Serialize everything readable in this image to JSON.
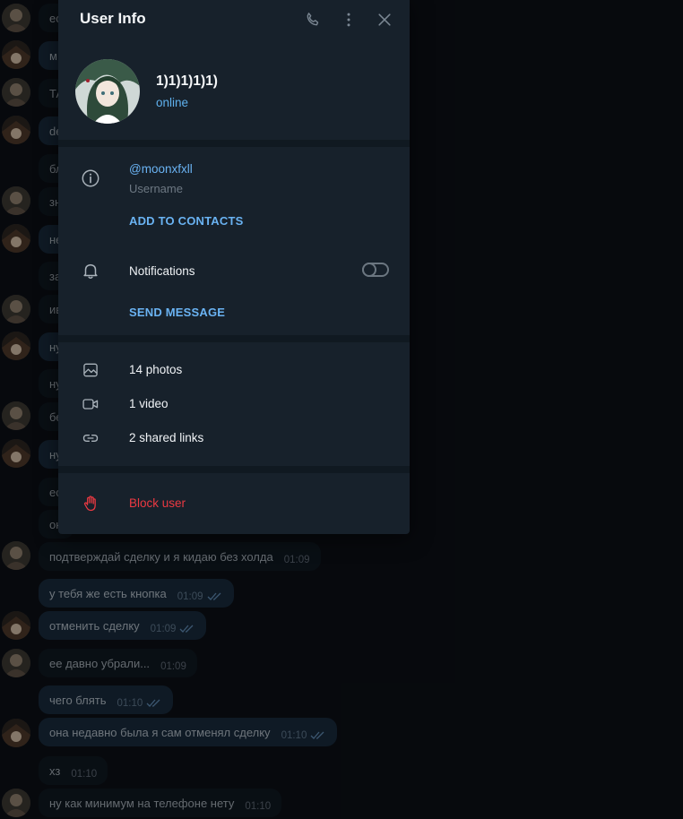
{
  "panel": {
    "title": "User Info",
    "name": "1)1)1)1)1)",
    "status": "online",
    "username": "@moonxfxll",
    "username_caption": "Username",
    "add_contacts": "ADD TO CONTACTS",
    "notifications": "Notifications",
    "notifications_enabled": false,
    "send_message": "SEND MESSAGE",
    "media": [
      {
        "label": "14 photos",
        "icon": "photo-icon"
      },
      {
        "label": "1 video",
        "icon": "video-icon"
      },
      {
        "label": "2 shared links",
        "icon": "link-icon"
      }
    ],
    "block": "Block user",
    "colors": {
      "accent": "#6ab3f3",
      "danger": "#ec3942",
      "panel_bg": "#17212b",
      "status": "#5fb1ee"
    }
  },
  "chat": {
    "messages": [
      {
        "dir": "in",
        "text": "ес",
        "time": ""
      },
      {
        "dir": "out",
        "text": "м",
        "time": ""
      },
      {
        "dir": "in",
        "text": "ТА",
        "time": ""
      },
      {
        "dir": "out",
        "text": "de",
        "time": ""
      },
      {
        "dir": "in",
        "text": "бл",
        "time": ""
      },
      {
        "dir": "in",
        "text": "зн",
        "time": ""
      },
      {
        "dir": "out",
        "text": "не",
        "time": ""
      },
      {
        "dir": "in",
        "text": "за",
        "time": ""
      },
      {
        "dir": "in",
        "text": "ив",
        "time": ""
      },
      {
        "dir": "out",
        "text": "ну",
        "time": ""
      },
      {
        "dir": "in",
        "text": "ну",
        "time": ""
      },
      {
        "dir": "in",
        "text": "бе",
        "time": ""
      },
      {
        "dir": "out",
        "text": "ну",
        "time": ""
      },
      {
        "dir": "in",
        "text": "ес",
        "time": ""
      },
      {
        "dir": "in",
        "text": "он",
        "time": ""
      },
      {
        "dir": "in",
        "text": "подтверждай сделку и я кидаю без холда",
        "time": "01:09"
      },
      {
        "dir": "out",
        "text": "у тебя же есть кнопка",
        "time": "01:09"
      },
      {
        "dir": "out",
        "text": "отменить сделку",
        "time": "01:09"
      },
      {
        "dir": "in",
        "text": "ее давно убрали...",
        "time": "01:09"
      },
      {
        "dir": "out",
        "text": "чего блять",
        "time": "01:10"
      },
      {
        "dir": "out",
        "text": "она недавно была я сам отменял сделку",
        "time": "01:10"
      },
      {
        "dir": "in",
        "text": "хз",
        "time": "01:10"
      },
      {
        "dir": "in",
        "text": "ну как минимум на телефоне нету",
        "time": "01:10"
      }
    ]
  }
}
